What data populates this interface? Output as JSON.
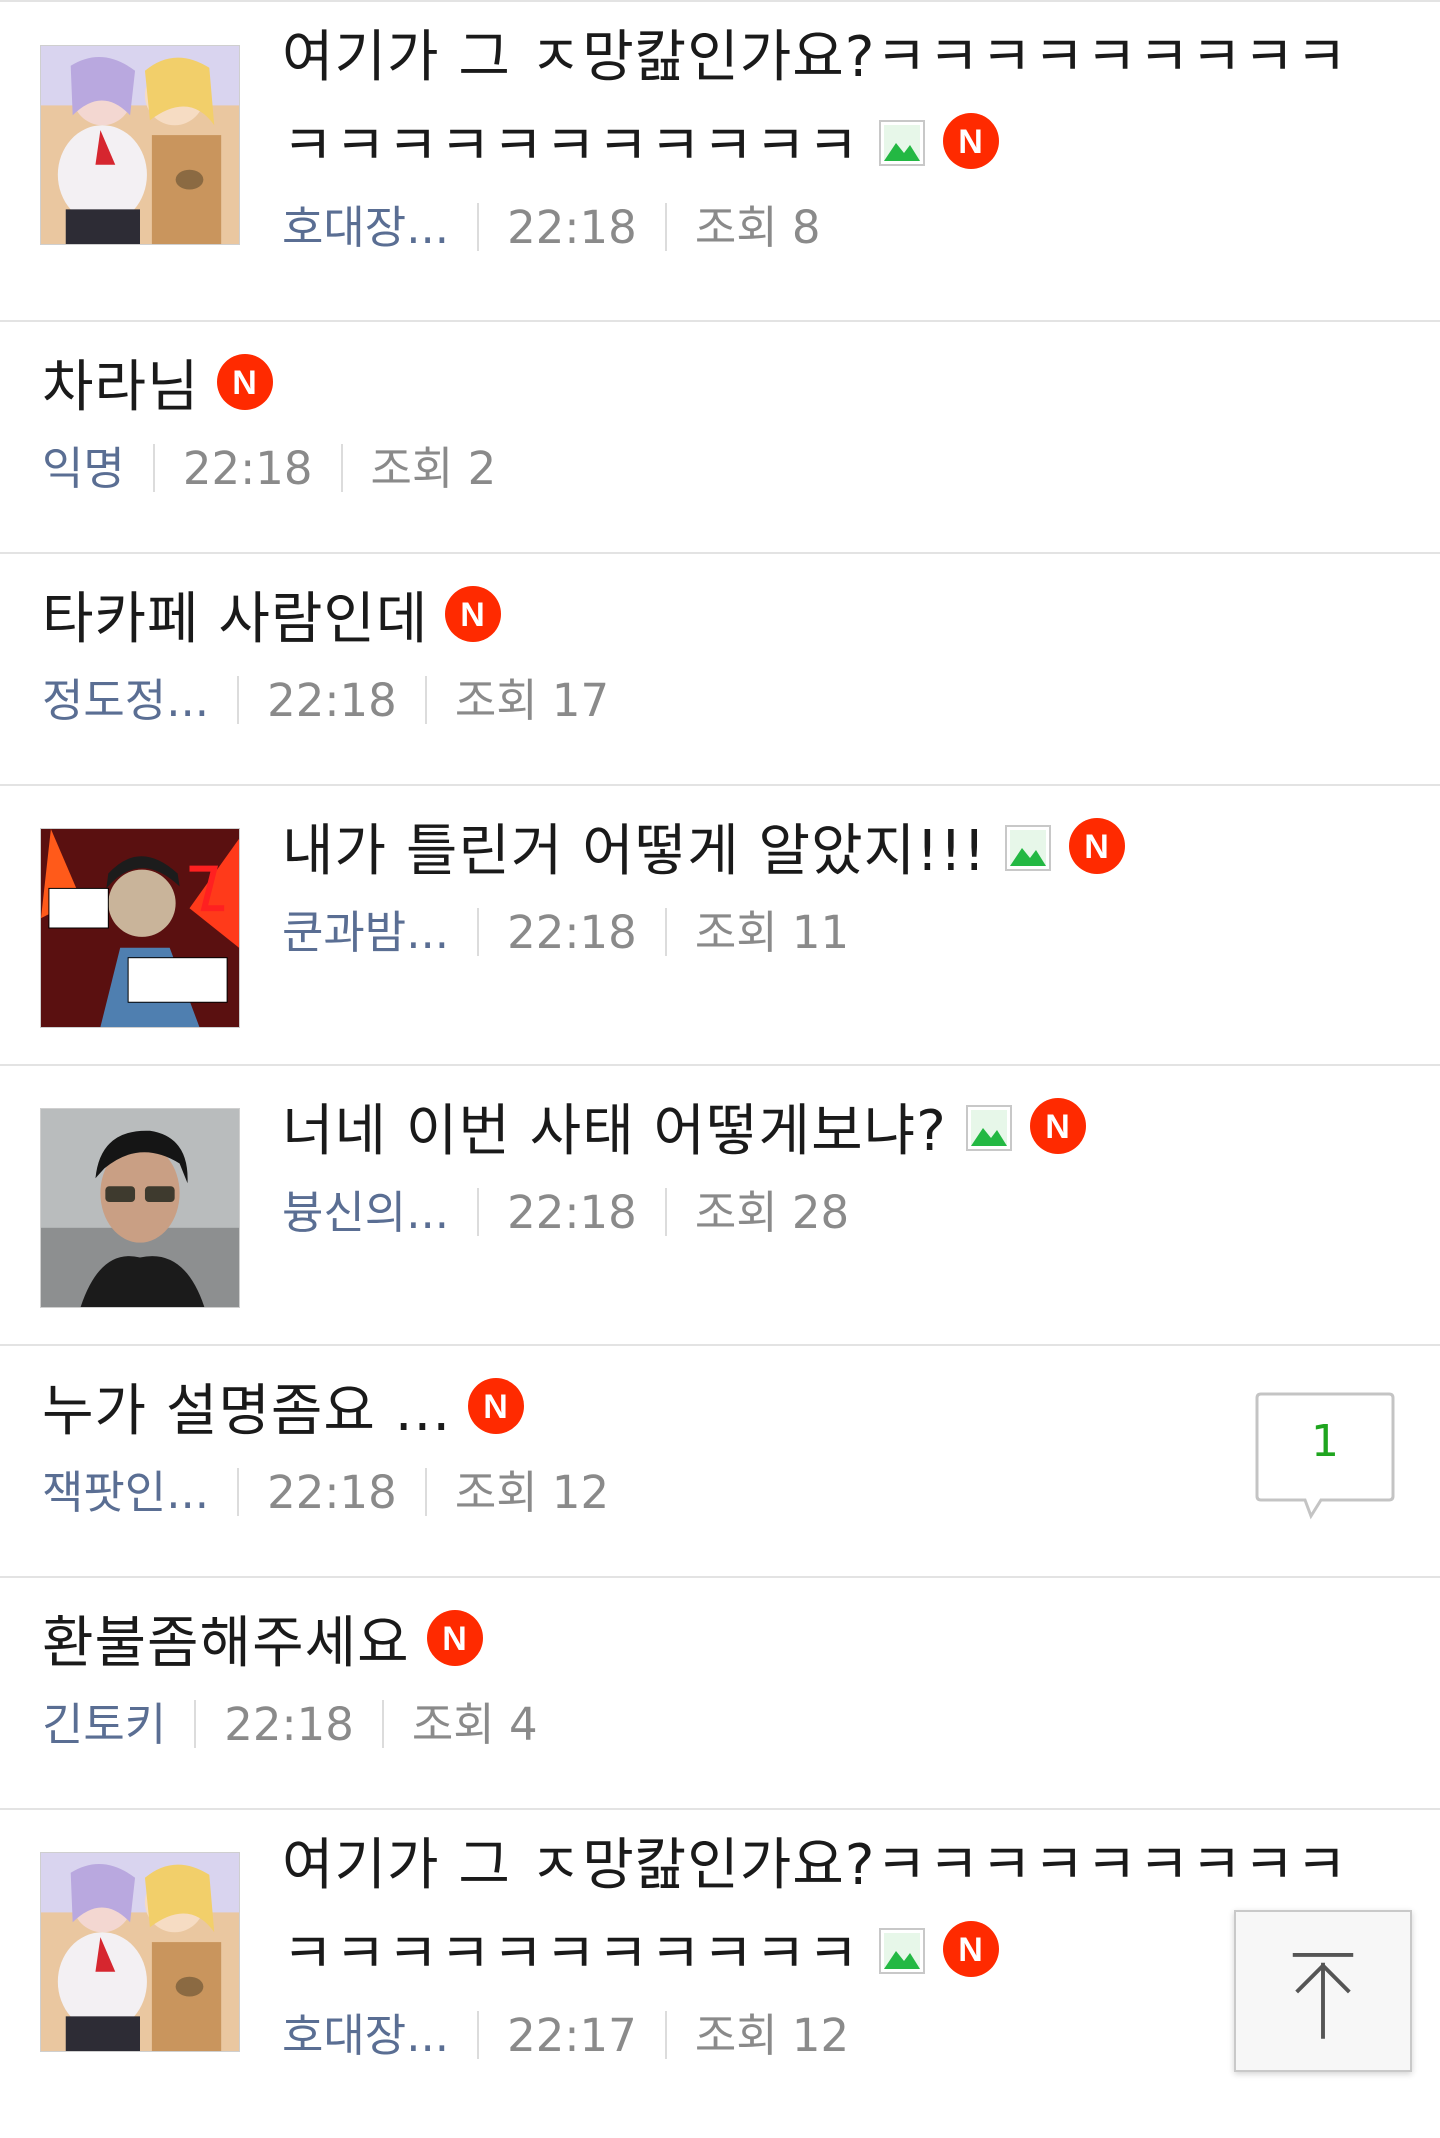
{
  "posts": [
    {
      "title": "여기가 그 ㅈ망캂인가요?ㅋㅋㅋㅋㅋㅋㅋㅋㅋㅋㅋㅋㅋㅋㅋㅋㅋㅋㅋㅋ",
      "author": "호대장...",
      "time": "22:18",
      "views": "조회 8",
      "thumbnail": "anime-girls",
      "has_image": true,
      "is_new": true
    },
    {
      "title": "차라님",
      "author": "익명",
      "time": "22:18",
      "views": "조회 2",
      "thumbnail": null,
      "has_image": false,
      "is_new": true
    },
    {
      "title": "타카페 사람인데",
      "author": "정도정...",
      "time": "22:18",
      "views": "조회 17",
      "thumbnail": null,
      "has_image": false,
      "is_new": true
    },
    {
      "title": "내가 틀린거 어떻게 알았지!!!",
      "author": "쿤과밤...",
      "time": "22:18",
      "views": "조회 11",
      "thumbnail": "webtoon-panel",
      "has_image": true,
      "is_new": true
    },
    {
      "title": "너네 이번 사태 어떻게보냐?",
      "author": "븅신의...",
      "time": "22:18",
      "views": "조회 28",
      "thumbnail": "man-sunglasses",
      "has_image": true,
      "is_new": true
    },
    {
      "title": "누가 설명좀요 ...",
      "author": "잭팟인...",
      "time": "22:18",
      "views": "조회 12",
      "thumbnail": null,
      "has_image": false,
      "is_new": true,
      "comment_count": "1"
    },
    {
      "title": "환불좀해주세요",
      "author": "긴토키",
      "time": "22:18",
      "views": "조회 4",
      "thumbnail": null,
      "has_image": false,
      "is_new": true
    },
    {
      "title": "여기가 그 ㅈ망캂인가요?ㅋㅋㅋㅋㅋㅋㅋㅋㅋㅋㅋㅋㅋㅋㅋㅋㅋㅋㅋㅋ",
      "author": "호대장...",
      "time": "22:17",
      "views": "조회 12",
      "thumbnail": "anime-girls",
      "has_image": true,
      "is_new": true
    }
  ],
  "icons": {
    "new_badge": "new-badge-icon",
    "image": "image-icon",
    "scroll_top": "arrow-up-icon",
    "comment": "speech-bubble-icon"
  },
  "colors": {
    "new_badge": "#ff2a00",
    "author": "#5a6e93",
    "meta": "#8a8a8a",
    "comment_count": "#1fa51f",
    "divider": "#e3e3e3"
  }
}
